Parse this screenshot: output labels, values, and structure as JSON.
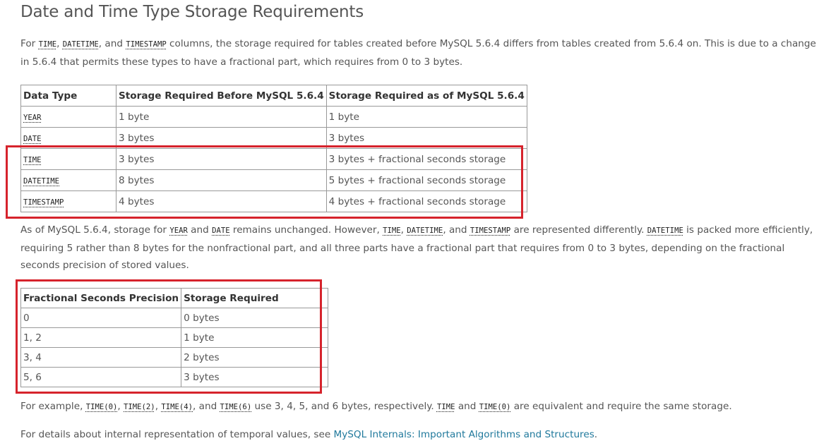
{
  "title": "Date and Time Type Storage Requirements",
  "intro": {
    "t1": "TIME",
    "s1": ", ",
    "t2": "DATETIME",
    "s2": ", and ",
    "t3": "TIMESTAMP",
    "s0": "For ",
    "s3": " columns, the storage required for tables created before MySQL 5.6.4 differs from tables created from 5.6.4 on. This is due to a change in 5.6.4 that permits these types to have a fractional part, which requires from 0 to 3 bytes."
  },
  "table1": {
    "headers": [
      "Data Type",
      "Storage Required Before MySQL 5.6.4",
      "Storage Required as of MySQL 5.6.4"
    ],
    "rows": [
      [
        "YEAR",
        "1 byte",
        "1 byte"
      ],
      [
        "DATE",
        "3 bytes",
        "3 bytes"
      ],
      [
        "TIME",
        "3 bytes",
        "3 bytes + fractional seconds storage"
      ],
      [
        "DATETIME",
        "8 bytes",
        "5 bytes + fractional seconds storage"
      ],
      [
        "TIMESTAMP",
        "4 bytes",
        "4 bytes + fractional seconds storage"
      ]
    ]
  },
  "para2": {
    "a": "As of MySQL 5.6.4, storage for ",
    "c1": "YEAR",
    "b": " and ",
    "c2": "DATE",
    "c": " remains unchanged. However, ",
    "c3": "TIME",
    "d": ", ",
    "c4": "DATETIME",
    "e": ", and ",
    "c5": "TIMESTAMP",
    "f": " are represented differently. ",
    "c6": "DATETIME",
    "g": " is packed more efficiently, requiring 5 rather than 8 bytes for the nonfractional part, and all three parts have a fractional part that requires from 0 to 3 bytes, depending on the fractional seconds precision of stored values."
  },
  "table2": {
    "headers": [
      "Fractional Seconds Precision",
      "Storage Required"
    ],
    "rows": [
      [
        "0",
        "0 bytes"
      ],
      [
        "1, 2",
        "1 byte"
      ],
      [
        "3, 4",
        "2 bytes"
      ],
      [
        "5, 6",
        "3 bytes"
      ]
    ]
  },
  "para3": {
    "a": "For example, ",
    "c1": "TIME(0)",
    "s1": ", ",
    "c2": "TIME(2)",
    "s2": ", ",
    "c3": "TIME(4)",
    "s3": ", and ",
    "c4": "TIME(6)",
    "b": " use 3, 4, 5, and 6 bytes, respectively. ",
    "c5": "TIME",
    "c": " and ",
    "c6": "TIME(0)",
    "d": " are equivalent and require the same storage."
  },
  "para4": {
    "a": "For details about internal representation of temporal values, see ",
    "link": "MySQL Internals: Important Algorithms and Structures",
    "b": "."
  },
  "colors": {
    "highlight": "#d6232c",
    "link": "#20799c",
    "text": "#555555"
  }
}
